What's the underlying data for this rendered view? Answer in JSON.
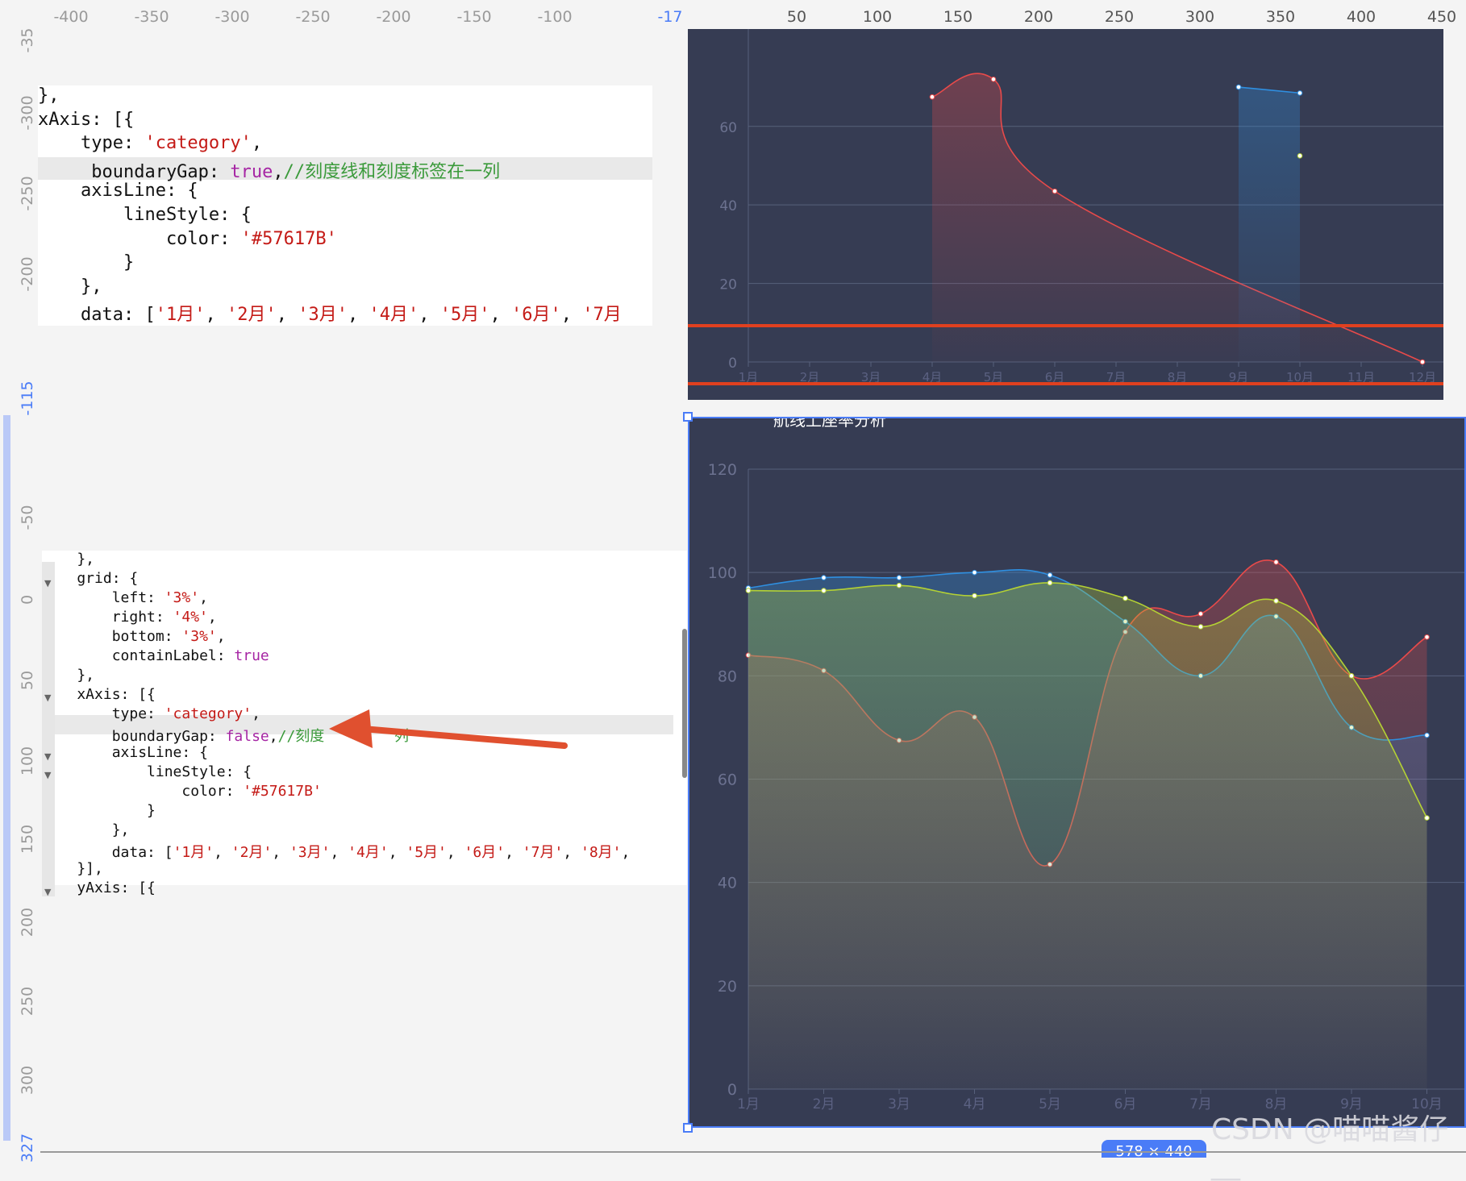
{
  "ruler_top": {
    "left_ticks": [
      "-400",
      "-350",
      "-300",
      "-250",
      "-200",
      "-150",
      "-100"
    ],
    "current_marker": "-17",
    "right_ticks": [
      "50",
      "100",
      "150",
      "200",
      "250",
      "300",
      "350",
      "400",
      "450"
    ]
  },
  "ruler_left": {
    "ticks": [
      "-35",
      "-300",
      "-250",
      "-200",
      "-115",
      "-50",
      "0",
      "50",
      "100",
      "150",
      "200",
      "250",
      "300",
      "327"
    ],
    "current_marker": "-115"
  },
  "code_top": {
    "lines": [
      [
        {
          "t": "},",
          "c": ""
        }
      ],
      [
        {
          "t": "xAxis: [{",
          "c": ""
        }
      ],
      [
        {
          "t": "    type: ",
          "c": ""
        },
        {
          "t": "'category'",
          "c": "str"
        },
        {
          "t": ",",
          "c": ""
        }
      ],
      [
        {
          "t": "     boundaryGap: ",
          "c": ""
        },
        {
          "t": "true",
          "c": "kw"
        },
        {
          "t": ",",
          "c": ""
        },
        {
          "t": "//刻度线和刻度标签在一列",
          "c": "cm"
        }
      ],
      [
        {
          "t": "    axisLine: {",
          "c": ""
        }
      ],
      [
        {
          "t": "        lineStyle: {",
          "c": ""
        }
      ],
      [
        {
          "t": "            color: ",
          "c": ""
        },
        {
          "t": "'#57617B'",
          "c": "str"
        }
      ],
      [
        {
          "t": "        }",
          "c": ""
        }
      ],
      [
        {
          "t": "    },",
          "c": ""
        }
      ],
      [
        {
          "t": "    data: [",
          "c": ""
        },
        {
          "t": "'1月'",
          "c": "str"
        },
        {
          "t": ", ",
          "c": ""
        },
        {
          "t": "'2月'",
          "c": "str"
        },
        {
          "t": ", ",
          "c": ""
        },
        {
          "t": "'3月'",
          "c": "str"
        },
        {
          "t": ", ",
          "c": ""
        },
        {
          "t": "'4月'",
          "c": "str"
        },
        {
          "t": ", ",
          "c": ""
        },
        {
          "t": "'5月'",
          "c": "str"
        },
        {
          "t": ", ",
          "c": ""
        },
        {
          "t": "'6月'",
          "c": "str"
        },
        {
          "t": ", ",
          "c": ""
        },
        {
          "t": "'7月",
          "c": "str"
        }
      ]
    ]
  },
  "code_bottom": {
    "lines": [
      [
        {
          "t": "    },",
          "c": ""
        }
      ],
      [
        {
          "t": "    grid: {",
          "c": ""
        }
      ],
      [
        {
          "t": "        left: ",
          "c": ""
        },
        {
          "t": "'3%'",
          "c": "str"
        },
        {
          "t": ",",
          "c": ""
        }
      ],
      [
        {
          "t": "        right: ",
          "c": ""
        },
        {
          "t": "'4%'",
          "c": "str"
        },
        {
          "t": ",",
          "c": ""
        }
      ],
      [
        {
          "t": "        bottom: ",
          "c": ""
        },
        {
          "t": "'3%'",
          "c": "str"
        },
        {
          "t": ",",
          "c": ""
        }
      ],
      [
        {
          "t": "        containLabel: ",
          "c": ""
        },
        {
          "t": "true",
          "c": "kw"
        }
      ],
      [
        {
          "t": "    },",
          "c": ""
        }
      ],
      [
        {
          "t": "    xAxis: [{",
          "c": ""
        }
      ],
      [
        {
          "t": "        type: ",
          "c": ""
        },
        {
          "t": "'category'",
          "c": "str"
        },
        {
          "t": ",",
          "c": ""
        }
      ],
      [
        {
          "t": "        boundaryGap: ",
          "c": ""
        },
        {
          "t": "false",
          "c": "kw"
        },
        {
          "t": ",",
          "c": ""
        },
        {
          "t": "//刻度",
          "c": "cm"
        },
        {
          "t": "        ",
          "c": ""
        },
        {
          "t": "列",
          "c": "cm"
        }
      ],
      [
        {
          "t": "        axisLine: {",
          "c": ""
        }
      ],
      [
        {
          "t": "            lineStyle: {",
          "c": ""
        }
      ],
      [
        {
          "t": "                color: ",
          "c": ""
        },
        {
          "t": "'#57617B'",
          "c": "str"
        }
      ],
      [
        {
          "t": "            }",
          "c": ""
        }
      ],
      [
        {
          "t": "        },",
          "c": ""
        }
      ],
      [
        {
          "t": "        data: [",
          "c": ""
        },
        {
          "t": "'1月'",
          "c": "str"
        },
        {
          "t": ", ",
          "c": ""
        },
        {
          "t": "'2月'",
          "c": "str"
        },
        {
          "t": ", ",
          "c": ""
        },
        {
          "t": "'3月'",
          "c": "str"
        },
        {
          "t": ", ",
          "c": ""
        },
        {
          "t": "'4月'",
          "c": "str"
        },
        {
          "t": ", ",
          "c": ""
        },
        {
          "t": "'5月'",
          "c": "str"
        },
        {
          "t": ", ",
          "c": ""
        },
        {
          "t": "'6月'",
          "c": "str"
        },
        {
          "t": ", ",
          "c": ""
        },
        {
          "t": "'7月'",
          "c": "str"
        },
        {
          "t": ", ",
          "c": ""
        },
        {
          "t": "'8月'",
          "c": "str"
        },
        {
          "t": ",",
          "c": ""
        }
      ],
      [
        {
          "t": "    }],",
          "c": ""
        }
      ],
      [
        {
          "t": "    yAxis: [{",
          "c": ""
        }
      ]
    ]
  },
  "colors": {
    "chart_bg": "#363c53",
    "grid": "#57617b",
    "series_red": "#e84a4a",
    "series_blue": "#2f8fe0",
    "series_yellow": "#b4d134",
    "arrow": "#e0502f",
    "ruler_highlight": "#4a7cf7"
  },
  "chart_data": [
    {
      "type": "line",
      "yticks": [
        "0",
        "20",
        "40",
        "60"
      ],
      "categories": [
        "1月",
        "2月",
        "3月",
        "4月",
        "5月",
        "6月",
        "7月",
        "8月",
        "9月",
        "10月",
        "11月",
        "12月"
      ],
      "series": [
        {
          "color": "#e84a4a",
          "values": [
            null,
            null,
            null,
            67.5,
            72,
            43.5,
            null,
            null,
            null,
            null,
            null,
            0
          ]
        },
        {
          "color": "#2f8fe0",
          "values": [
            null,
            null,
            null,
            null,
            null,
            null,
            null,
            null,
            70,
            68.5,
            null,
            null
          ]
        },
        {
          "color": "#b4d134",
          "values": [
            null,
            null,
            null,
            null,
            null,
            null,
            null,
            null,
            null,
            52.5,
            null,
            null
          ]
        }
      ]
    },
    {
      "type": "line",
      "title": "航线上座率分析",
      "yticks": [
        "0",
        "20",
        "40",
        "60",
        "80",
        "100",
        "120"
      ],
      "ylim": [
        0,
        120
      ],
      "categories": [
        "1月",
        "2月",
        "3月",
        "4月",
        "5月",
        "6月",
        "7月",
        "8月",
        "9月",
        "10月"
      ],
      "series": [
        {
          "color": "#e84a4a",
          "values": [
            84,
            81,
            67.5,
            72,
            43.5,
            88.5,
            92,
            102,
            80,
            87.5
          ]
        },
        {
          "color": "#2f8fe0",
          "values": [
            97,
            99,
            99,
            100,
            99.5,
            90.5,
            80,
            91.5,
            70,
            68.5
          ]
        },
        {
          "color": "#b4d134",
          "values": [
            96.5,
            96.5,
            97.5,
            95.5,
            98,
            95,
            89.5,
            94.5,
            80,
            52.5
          ]
        }
      ]
    }
  ],
  "watermark": "CSDN @喵喵酱仔__",
  "size_badge": "578 × 440"
}
